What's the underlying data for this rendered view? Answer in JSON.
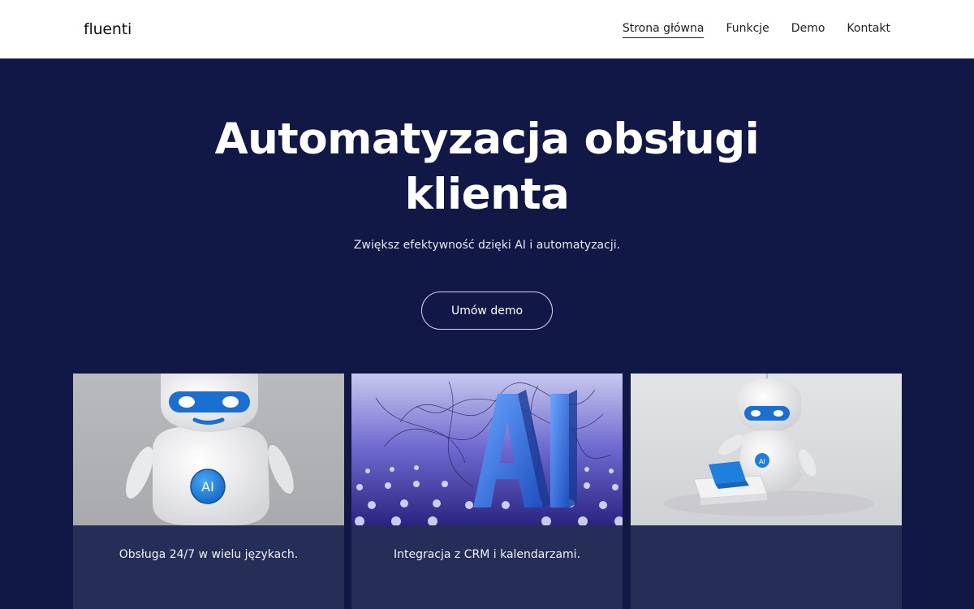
{
  "header": {
    "logo": "fluenti",
    "nav": [
      {
        "label": "Strona główna",
        "active": true
      },
      {
        "label": "Funkcje",
        "active": false
      },
      {
        "label": "Demo",
        "active": false
      },
      {
        "label": "Kontakt",
        "active": false
      }
    ]
  },
  "hero": {
    "title": "Automatyzacja obsługi klienta",
    "subtitle": "Zwiększ efektywność dzięki AI i automatyzacji.",
    "cta_label": "Umów demo"
  },
  "cards": [
    {
      "image": "robot-portrait",
      "badge": "AI",
      "caption": "Obsługa 24/7 w wielu językach."
    },
    {
      "image": "ai-3d-letters",
      "badge": "AI",
      "caption": "Integracja z CRM i kalendarzami."
    },
    {
      "image": "robot-with-laptop",
      "badge": "AI",
      "caption": ""
    }
  ],
  "colors": {
    "header_bg": "#ffffff",
    "hero_bg": "#111845",
    "card_bg": "#252e57",
    "accent_blue": "#1e7fdc"
  }
}
